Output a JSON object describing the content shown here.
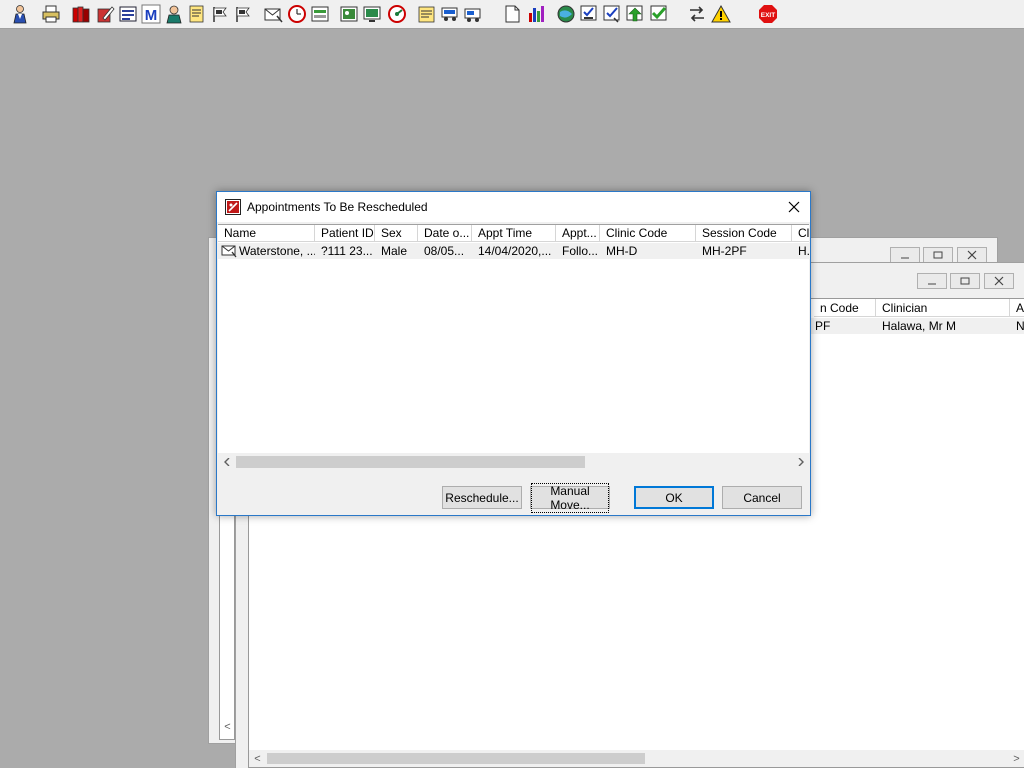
{
  "toolbar": {
    "icons": [
      "user-icon",
      "printer-icon",
      "books-icon",
      "edit-icon",
      "chart-icon",
      "m-icon",
      "person-icon",
      "notepad-icon",
      "flag-icon",
      "flag-icon",
      "envelope-icon",
      "clock-icon",
      "form-icon",
      "picture-icon",
      "screen-icon",
      "dial-icon",
      "notes-icon",
      "transport-icon",
      "ambulance-icon",
      "document-icon",
      "bar-chart-icon",
      "globe-icon",
      "checklist-icon",
      "check-form-icon",
      "green-arrow-icon",
      "green-check-icon",
      "swap-icon",
      "warning-icon",
      "exit-icon"
    ],
    "exit_label": "EXIT"
  },
  "background_window": {
    "columns": [
      "n Code",
      "Clinician",
      "A"
    ],
    "row": [
      "PF",
      "Halawa, Mr M",
      "N"
    ]
  },
  "dialog": {
    "title": "Appointments To Be Rescheduled",
    "columns": [
      "Name",
      "Patient ID",
      "Sex",
      "Date o...",
      "Appt Time",
      "Appt...",
      "Clinic Code",
      "Session Code",
      "Cl"
    ],
    "rows": [
      {
        "name": "Waterstone, ...",
        "patient_id": "?111 23...",
        "sex": "Male",
        "dob": "08/05...",
        "appt_time": "14/04/2020,...",
        "appt_type": "Follo...",
        "clinic_code": "MH-D",
        "session_code": "MH-2PF",
        "clinician": "H..."
      }
    ],
    "buttons": {
      "reschedule": "Reschedule...",
      "manual_move": "Manual Move...",
      "ok": "OK",
      "cancel": "Cancel"
    }
  },
  "colors": {
    "desktop": "#ababab",
    "dialog_border": "#2a78c8",
    "row_bg": "#f0f0f0"
  }
}
